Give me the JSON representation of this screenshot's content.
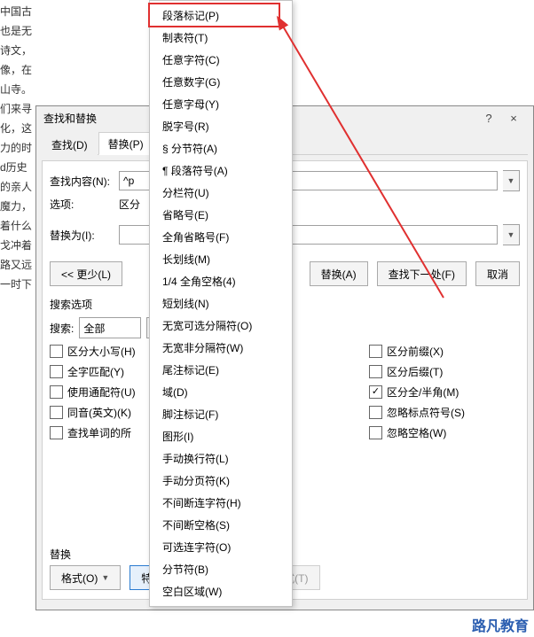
{
  "bg_text": "中国古也是无诗文，   像，在山寺。们来寻化，这力的时d历史的亲人   魔力，着什么   戈冲着路又远一时下",
  "dialog": {
    "title": "查找和替换",
    "help": "?",
    "close": "×",
    "tabs": {
      "find": "查找(D)",
      "replace": "替换(P)"
    },
    "labels": {
      "find_what": "查找内容(N):",
      "options": "选项:",
      "replace_with": "替换为(I):",
      "less": "<< 更少(L)",
      "replace_all": "替换(A)",
      "find_next": "查找下一处(F)",
      "cancel": "取消",
      "search_options": "搜索选项",
      "search": "搜索:",
      "search_scope": "全部",
      "replace_section": "替换",
      "format": "格式(O)",
      "special": "特殊格式(E)",
      "no_format": "不限定格式(T)"
    },
    "find_value": "^p",
    "options_value": "区分",
    "checks_left": [
      {
        "label": "区分大小写(H)",
        "checked": false
      },
      {
        "label": "全字匹配(Y)",
        "checked": false
      },
      {
        "label": "使用通配符(U)",
        "checked": false
      },
      {
        "label": "同音(英文)(K)",
        "checked": false
      },
      {
        "label": "查找单词的所",
        "checked": false
      }
    ],
    "checks_right": [
      {
        "label": "区分前缀(X)",
        "checked": false
      },
      {
        "label": "区分后缀(T)",
        "checked": false
      },
      {
        "label": "区分全/半角(M)",
        "checked": true
      },
      {
        "label": "忽略标点符号(S)",
        "checked": false
      },
      {
        "label": "忽略空格(W)",
        "checked": false
      }
    ]
  },
  "menu_items": [
    "段落标记(P)",
    "制表符(T)",
    "任意字符(C)",
    "任意数字(G)",
    "任意字母(Y)",
    "脱字号(R)",
    "§ 分节符(A)",
    "¶ 段落符号(A)",
    "分栏符(U)",
    "省略号(E)",
    "全角省略号(F)",
    "长划线(M)",
    "1/4 全角空格(4)",
    "短划线(N)",
    "无宽可选分隔符(O)",
    "无宽非分隔符(W)",
    "尾注标记(E)",
    "域(D)",
    "脚注标记(F)",
    "图形(I)",
    "手动换行符(L)",
    "手动分页符(K)",
    "不间断连字符(H)",
    "不间断空格(S)",
    "可选连字符(O)",
    "分节符(B)",
    "空白区域(W)"
  ],
  "footer": "路凡教育"
}
